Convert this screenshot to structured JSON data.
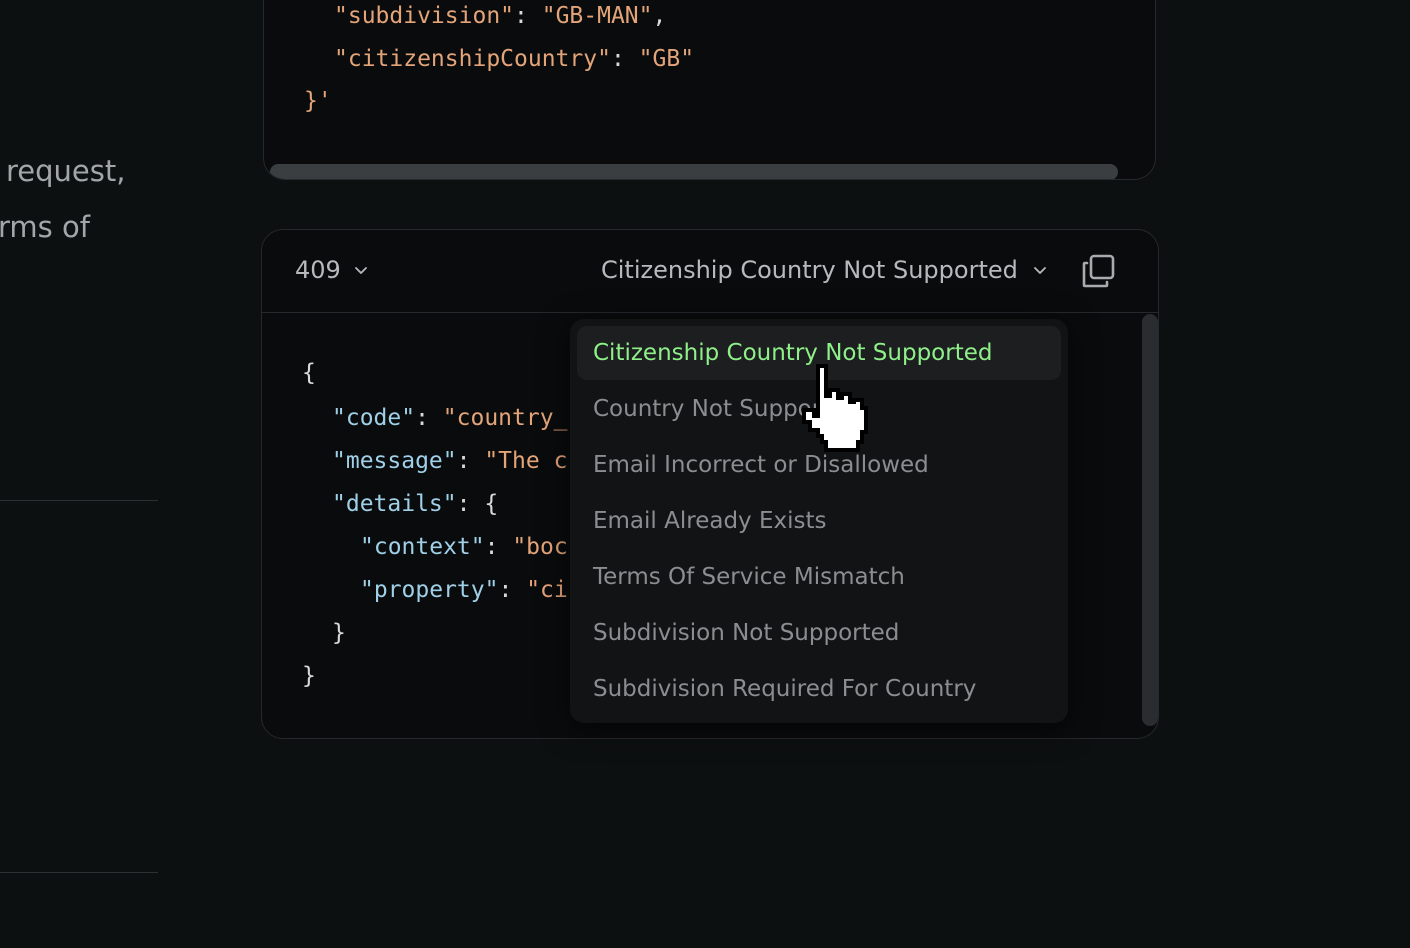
{
  "prose": {
    "line1": "request,",
    "line2": "rms of"
  },
  "request_code": {
    "line1_key": "\"subdivision\"",
    "line1_sep": ": ",
    "line1_val": "\"GB-MAN\"",
    "line1_end": ",",
    "line2_key": "\"citizenshipCountry\"",
    "line2_sep": ": ",
    "line2_val": "\"GB\"",
    "line3": "}'"
  },
  "response": {
    "status_code": "409",
    "error_selected": "Citizenship Country Not Supported",
    "icons": {
      "status_chevron": "chevron-down-icon",
      "error_chevron": "chevron-down-icon",
      "copy": "copy-icon"
    },
    "body": {
      "open": "{",
      "code_key": "\"code\"",
      "code_val": "\"country_",
      "message_key": "\"message\"",
      "message_val": "\"The c",
      "details_key": "\"details\"",
      "details_open": ": {",
      "context_key": "\"context\"",
      "context_val": "\"boc",
      "property_key": "\"property\"",
      "property_val": "\"ci",
      "inner_close": "}",
      "close": "}",
      "sep": ": "
    }
  },
  "dropdown": {
    "items": [
      {
        "label": "Citizenship Country Not Supported",
        "selected": true
      },
      {
        "label": "Country Not Supported",
        "selected": false
      },
      {
        "label": "Email Incorrect or Disallowed",
        "selected": false
      },
      {
        "label": "Email Already Exists",
        "selected": false
      },
      {
        "label": "Terms Of Service Mismatch",
        "selected": false
      },
      {
        "label": "Subdivision Not Supported",
        "selected": false
      },
      {
        "label": "Subdivision Required For Country",
        "selected": false
      }
    ]
  },
  "colors": {
    "background": "#0d1011",
    "selected_item": "#8ff08a",
    "string": "#e4a47a",
    "key": "#9fd0e8"
  }
}
